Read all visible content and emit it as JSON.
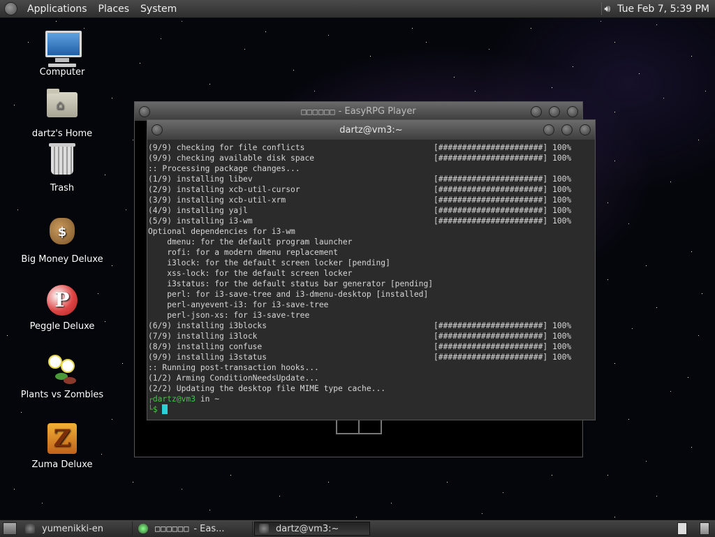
{
  "top_panel": {
    "menus": [
      "Applications",
      "Places",
      "System"
    ],
    "clock": "Tue Feb  7,  5:39 PM"
  },
  "desktop_icons": [
    {
      "label": "Computer",
      "icon": "computer-icon"
    },
    {
      "label": "dartz's Home",
      "icon": "home-folder-icon"
    },
    {
      "label": "Trash",
      "icon": "trash-icon"
    },
    {
      "label": "Big Money Deluxe",
      "icon": "money-bag-icon"
    },
    {
      "label": "Peggle Deluxe",
      "icon": "peggle-icon"
    },
    {
      "label": "Plants vs Zombies",
      "icon": "plants-vs-zombies-icon"
    },
    {
      "label": "Zuma Deluxe",
      "icon": "zuma-icon"
    }
  ],
  "easyrpg_window": {
    "title_glyphs": "□□□□□□",
    "title": "- EasyRPG Player"
  },
  "terminal": {
    "title": "dartz@vm3:~",
    "lines": [
      {
        "l": "(9/9) checking for file conflicts",
        "r": "[######################] 100%"
      },
      {
        "l": "(9/9) checking available disk space",
        "r": "[######################] 100%"
      },
      {
        "l": ":: Processing package changes...",
        "r": ""
      },
      {
        "l": "(1/9) installing libev",
        "r": "[######################] 100%"
      },
      {
        "l": "(2/9) installing xcb-util-cursor",
        "r": "[######################] 100%"
      },
      {
        "l": "(3/9) installing xcb-util-xrm",
        "r": "[######################] 100%"
      },
      {
        "l": "(4/9) installing yajl",
        "r": "[######################] 100%"
      },
      {
        "l": "(5/9) installing i3-wm",
        "r": "[######################] 100%"
      },
      {
        "l": "Optional dependencies for i3-wm",
        "r": ""
      },
      {
        "l": "    dmenu: for the default program launcher",
        "r": ""
      },
      {
        "l": "    rofi: for a modern dmenu replacement",
        "r": ""
      },
      {
        "l": "    i3lock: for the default screen locker [pending]",
        "r": ""
      },
      {
        "l": "    xss-lock: for the default screen locker",
        "r": ""
      },
      {
        "l": "    i3status: for the default status bar generator [pending]",
        "r": ""
      },
      {
        "l": "    perl: for i3-save-tree and i3-dmenu-desktop [installed]",
        "r": ""
      },
      {
        "l": "    perl-anyevent-i3: for i3-save-tree",
        "r": ""
      },
      {
        "l": "    perl-json-xs: for i3-save-tree",
        "r": ""
      },
      {
        "l": "(6/9) installing i3blocks",
        "r": "[######################] 100%"
      },
      {
        "l": "(7/9) installing i3lock",
        "r": "[######################] 100%"
      },
      {
        "l": "(8/9) installing confuse",
        "r": "[######################] 100%"
      },
      {
        "l": "(9/9) installing i3status",
        "r": "[######################] 100%"
      },
      {
        "l": ":: Running post-transaction hooks...",
        "r": ""
      },
      {
        "l": "(1/2) Arming ConditionNeedsUpdate...",
        "r": ""
      },
      {
        "l": "(2/2) Updating the desktop file MIME type cache...",
        "r": ""
      }
    ],
    "prompt_user": "dartz@vm3",
    "prompt_in": " in ~",
    "prompt_dollar": "$"
  },
  "taskbar": {
    "tasks": [
      {
        "label": "yumenikki-en",
        "glyphs": "",
        "active": false
      },
      {
        "label": "- Eas...",
        "glyphs": "□□□□□□",
        "active": false
      },
      {
        "label": "dartz@vm3:~",
        "glyphs": "",
        "active": true
      }
    ]
  }
}
